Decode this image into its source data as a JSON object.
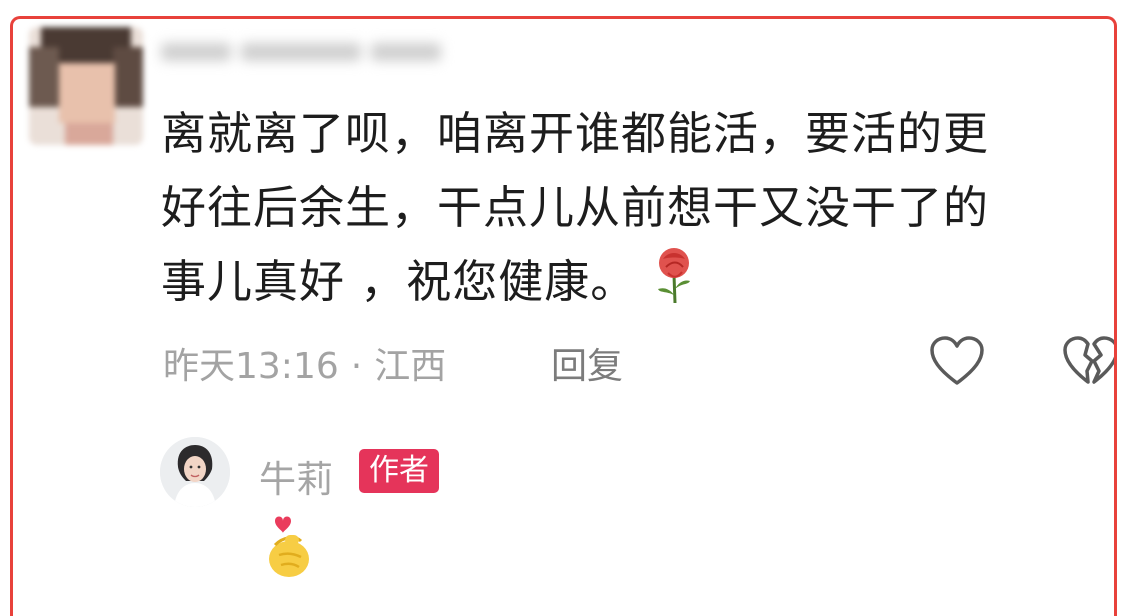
{
  "comment": {
    "lines": [
      "离就离了呗，咱离开谁都能活，要活的更",
      "好往后余生，干点儿从前想干又没干了的",
      "事儿真好 ，祝您健康。"
    ],
    "emoji": "rose-icon",
    "time": "昨天13:16",
    "separator": "·",
    "location": "江西",
    "reply_label": "回复"
  },
  "author_reply": {
    "name": "牛莉",
    "badge": "作者",
    "emoji": "finger-heart-icon"
  },
  "colors": {
    "frame_border": "#e8413b",
    "badge_bg": "#e5345a",
    "meta_text": "#a3a3a3",
    "body_text": "#1d1d1d"
  }
}
